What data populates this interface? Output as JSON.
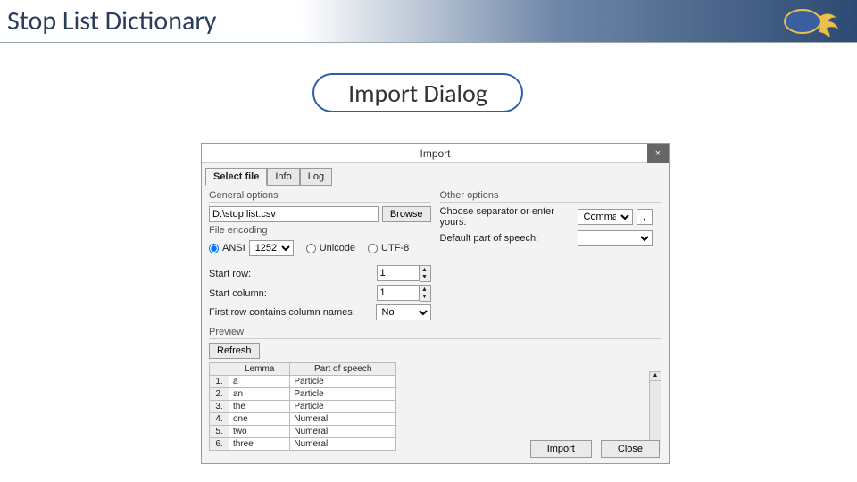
{
  "slide": {
    "title": "Stop List Dictionary"
  },
  "callout": {
    "label": "Import Dialog"
  },
  "dialog": {
    "title": "Import",
    "close_glyph": "×",
    "tabs": [
      "Select file",
      "Info",
      "Log"
    ],
    "general": {
      "legend": "General options",
      "file_path": "D:\\stop list.csv",
      "browse": "Browse",
      "encoding_legend": "File encoding",
      "enc_ansi": "ANSI",
      "enc_code": "1252",
      "enc_unicode": "Unicode",
      "enc_utf8": "UTF-8",
      "start_row_label": "Start row:",
      "start_row": "1",
      "start_col_label": "Start column:",
      "start_col": "1",
      "first_row_label": "First row contains column names:",
      "first_row_value": "No"
    },
    "other": {
      "legend": "Other options",
      "sep_label": "Choose separator or enter yours:",
      "sep_value": "Comma",
      "sep_char": ",",
      "pos_label": "Default part of speech:",
      "pos_value": ""
    },
    "preview": {
      "legend": "Preview",
      "refresh": "Refresh",
      "headers": [
        "",
        "Lemma",
        "Part of speech"
      ],
      "rows": [
        {
          "n": "1.",
          "lemma": "a",
          "pos": "Particle"
        },
        {
          "n": "2.",
          "lemma": "an",
          "pos": "Particle"
        },
        {
          "n": "3.",
          "lemma": "the",
          "pos": "Particle"
        },
        {
          "n": "4.",
          "lemma": "one",
          "pos": "Numeral"
        },
        {
          "n": "5.",
          "lemma": "two",
          "pos": "Numeral"
        },
        {
          "n": "6.",
          "lemma": "three",
          "pos": "Numeral"
        }
      ]
    },
    "buttons": {
      "import": "Import",
      "close": "Close"
    }
  }
}
